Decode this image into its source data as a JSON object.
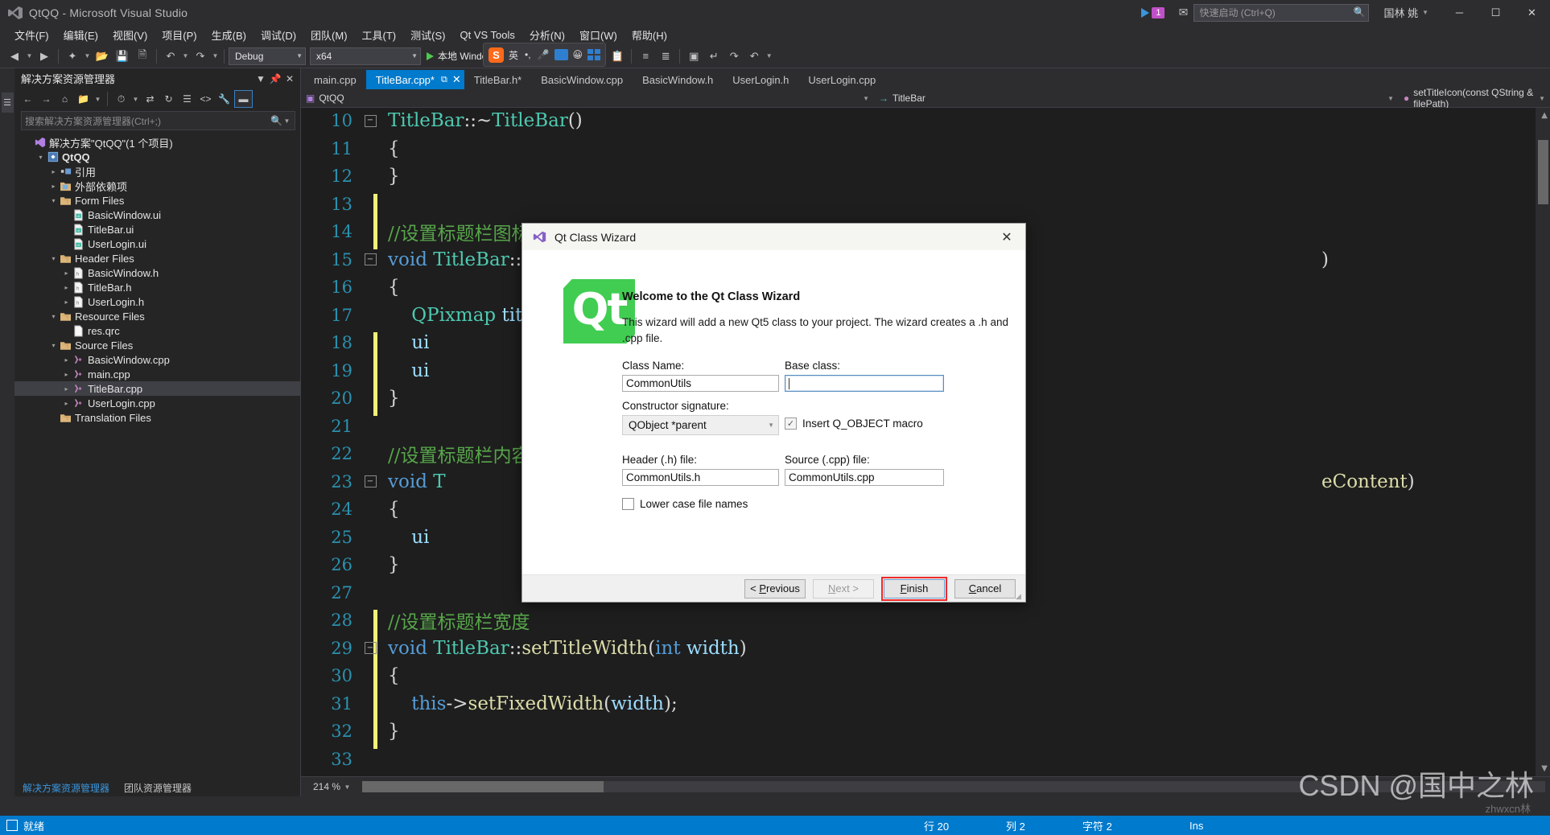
{
  "window": {
    "title": "QtQQ - Microsoft Visual Studio",
    "quick_launch_placeholder": "快速启动 (Ctrl+Q)",
    "account": "国林 姚",
    "notification_badge": "1",
    "minimize": "─",
    "maximize": "☐",
    "close": "✕"
  },
  "menu": [
    {
      "label": "文件(F)"
    },
    {
      "label": "编辑(E)"
    },
    {
      "label": "视图(V)"
    },
    {
      "label": "项目(P)"
    },
    {
      "label": "生成(B)"
    },
    {
      "label": "调试(D)"
    },
    {
      "label": "团队(M)"
    },
    {
      "label": "工具(T)"
    },
    {
      "label": "测试(S)"
    },
    {
      "label": "Qt VS Tools"
    },
    {
      "label": "分析(N)"
    },
    {
      "label": "窗口(W)"
    },
    {
      "label": "帮助(H)"
    }
  ],
  "toolbar": {
    "config": "Debug",
    "platform": "x64",
    "run_label": "本地 Windows 调试器",
    "sogou_mode": "英"
  },
  "solution_explorer": {
    "title": "解决方案资源管理器",
    "search_placeholder": "搜索解决方案资源管理器(Ctrl+;)",
    "tree": [
      {
        "label": "解决方案\"QtQQ\"(1 个项目)",
        "indent": 0,
        "arrow": "none",
        "icon": "solution-icon",
        "bold": false
      },
      {
        "label": "QtQQ",
        "indent": 1,
        "arrow": "down",
        "icon": "project-icon",
        "bold": true
      },
      {
        "label": "引用",
        "indent": 2,
        "arrow": "right",
        "icon": "references-icon",
        "bold": false
      },
      {
        "label": "外部依赖项",
        "indent": 2,
        "arrow": "right",
        "icon": "folder-icon",
        "bold": false
      },
      {
        "label": "Form Files",
        "indent": 2,
        "arrow": "down",
        "icon": "filter-folder-icon",
        "bold": false
      },
      {
        "label": "BasicWindow.ui",
        "indent": 3,
        "arrow": "none",
        "icon": "ui-file-icon",
        "bold": false
      },
      {
        "label": "TitleBar.ui",
        "indent": 3,
        "arrow": "none",
        "icon": "ui-file-icon",
        "bold": false
      },
      {
        "label": "UserLogin.ui",
        "indent": 3,
        "arrow": "none",
        "icon": "ui-file-icon",
        "bold": false
      },
      {
        "label": "Header Files",
        "indent": 2,
        "arrow": "down",
        "icon": "filter-folder-icon",
        "bold": false
      },
      {
        "label": "BasicWindow.h",
        "indent": 3,
        "arrow": "right",
        "icon": "h-file-icon",
        "bold": false
      },
      {
        "label": "TitleBar.h",
        "indent": 3,
        "arrow": "right",
        "icon": "h-file-icon",
        "bold": false
      },
      {
        "label": "UserLogin.h",
        "indent": 3,
        "arrow": "right",
        "icon": "h-file-icon",
        "bold": false
      },
      {
        "label": "Resource Files",
        "indent": 2,
        "arrow": "down",
        "icon": "filter-folder-icon",
        "bold": false
      },
      {
        "label": "res.qrc",
        "indent": 3,
        "arrow": "none",
        "icon": "generic-file-icon",
        "bold": false
      },
      {
        "label": "Source Files",
        "indent": 2,
        "arrow": "down",
        "icon": "filter-folder-icon",
        "bold": false
      },
      {
        "label": "BasicWindow.cpp",
        "indent": 3,
        "arrow": "right",
        "icon": "cpp-file-icon",
        "bold": false
      },
      {
        "label": "main.cpp",
        "indent": 3,
        "arrow": "right",
        "icon": "cpp-file-icon",
        "bold": false
      },
      {
        "label": "TitleBar.cpp",
        "indent": 3,
        "arrow": "right",
        "icon": "cpp-file-icon",
        "bold": false,
        "selected": true
      },
      {
        "label": "UserLogin.cpp",
        "indent": 3,
        "arrow": "right",
        "icon": "cpp-file-icon",
        "bold": false
      },
      {
        "label": "Translation Files",
        "indent": 2,
        "arrow": "none",
        "icon": "filter-folder-icon",
        "bold": false
      }
    ],
    "bottom_tabs": [
      {
        "label": "解决方案资源管理器",
        "active": true
      },
      {
        "label": "团队资源管理器",
        "active": false
      }
    ]
  },
  "editor": {
    "tabs": [
      {
        "label": "main.cpp",
        "active": false
      },
      {
        "label": "TitleBar.cpp*",
        "active": true
      },
      {
        "label": "TitleBar.h*",
        "active": false
      },
      {
        "label": "BasicWindow.cpp",
        "active": false
      },
      {
        "label": "BasicWindow.h",
        "active": false
      },
      {
        "label": "UserLogin.h",
        "active": false
      },
      {
        "label": "UserLogin.cpp",
        "active": false
      }
    ],
    "nav_project": "QtQQ",
    "nav_class": "TitleBar",
    "nav_member": "setTitleIcon(const QString & filePath)",
    "zoom": "214 %",
    "lines": [
      {
        "num": "10",
        "fold": "minus",
        "changed": false
      },
      {
        "num": "11",
        "fold": "",
        "changed": false
      },
      {
        "num": "12",
        "fold": "",
        "changed": false
      },
      {
        "num": "13",
        "fold": "",
        "changed": true
      },
      {
        "num": "14",
        "fold": "",
        "changed": true
      },
      {
        "num": "15",
        "fold": "minus",
        "changed": false
      },
      {
        "num": "16",
        "fold": "",
        "changed": false
      },
      {
        "num": "17",
        "fold": "",
        "changed": false
      },
      {
        "num": "18",
        "fold": "",
        "changed": true
      },
      {
        "num": "19",
        "fold": "",
        "changed": true
      },
      {
        "num": "20",
        "fold": "",
        "changed": true
      },
      {
        "num": "21",
        "fold": "",
        "changed": false
      },
      {
        "num": "22",
        "fold": "",
        "changed": false
      },
      {
        "num": "23",
        "fold": "minus",
        "changed": false
      },
      {
        "num": "24",
        "fold": "",
        "changed": false
      },
      {
        "num": "25",
        "fold": "",
        "changed": false
      },
      {
        "num": "26",
        "fold": "",
        "changed": false
      },
      {
        "num": "27",
        "fold": "",
        "changed": false
      },
      {
        "num": "28",
        "fold": "",
        "changed": true
      },
      {
        "num": "29",
        "fold": "minus",
        "changed": true
      },
      {
        "num": "30",
        "fold": "",
        "changed": true
      },
      {
        "num": "31",
        "fold": "",
        "changed": true
      },
      {
        "num": "32",
        "fold": "",
        "changed": true
      },
      {
        "num": "33",
        "fold": "",
        "changed": false
      }
    ],
    "code": {
      "l10": "TitleBar::~TitleBar()",
      "l11": "{",
      "l12": "}",
      "l14": "//设置标题栏图标",
      "l15": "void TitleBar::setTitleIcon(const QString & filePath)",
      "l16": "{",
      "l17": "QPixmap titleIcon(filePath);",
      "l20": "}",
      "l22": "//设置标题栏内容",
      "l23": "void TitleBar::setTitleContent(QString titleContent)",
      "l24": "{",
      "l26": "}",
      "l28": "//设置标题栏宽度",
      "l29": "void TitleBar::setTitleWidth(int width)",
      "l30": "{",
      "l31": "this->setFixedWidth(width);",
      "l32": "}"
    }
  },
  "dialog": {
    "title": "Qt Class Wizard",
    "close": "✕",
    "logo_text": "Qt",
    "heading": "Welcome to the Qt Class Wizard",
    "description": "This wizard will add a new Qt5 class to your project. The wizard creates a .h and .cpp file.",
    "class_name_label": "Class Name:",
    "class_name_value": "CommonUtils",
    "base_class_label": "Base class:",
    "base_class_value": "",
    "constructor_label": "Constructor signature:",
    "constructor_value": "QObject *parent",
    "q_object_label": "Insert Q_OBJECT macro",
    "q_object_checked": true,
    "header_label": "Header (.h) file:",
    "header_value": "CommonUtils.h",
    "source_label": "Source (.cpp) file:",
    "source_value": "CommonUtils.cpp",
    "lowercase_label": "Lower case file names",
    "lowercase_checked": false,
    "buttons": {
      "previous": "< Previous",
      "next": "Next >",
      "finish": "Finish",
      "cancel": "Cancel"
    }
  },
  "statusbar": {
    "ready": "就绪",
    "line_label": "行 20",
    "col_label": "列 2",
    "char_label": "字符 2",
    "ins_label": "Ins"
  },
  "watermark": {
    "main": "CSDN @国中之林",
    "sub": "zhwxcn林"
  },
  "colors": {
    "accent": "#007acc",
    "active_tab": "#007acc",
    "qt_green": "#41cd52",
    "highlight_red": "#f02a2a"
  }
}
